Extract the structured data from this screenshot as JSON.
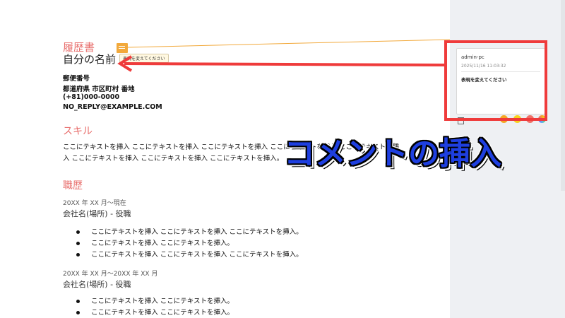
{
  "document": {
    "heading": "履歴書",
    "name": "自分の名前",
    "contact": [
      "郵便番号",
      "都道府県 市区町村 番地",
      "(+81)000-0000",
      "NO_REPLY@EXAMPLE.COM"
    ],
    "skills_heading": "スキル",
    "skills_lines": [
      "ここにテキストを挿入 ここにテキストを挿入 ここにテキストを挿入 ここにテキストを挿入 ここにテキストを挿",
      "入 ここにテキストを挿入 ここにテキストを挿入 ここにテキストを挿入。"
    ],
    "experience_heading": "職歴",
    "jobs": [
      {
        "period": "20XX 年 XX 月～現在",
        "company": "会社名(場所) - 役職",
        "bullets": [
          "ここにテキストを挿入 ここにテキストを挿入 ここにテキストを挿入。",
          "ここにテキストを挿入 ここにテキストを挿入。",
          "ここにテキストを挿入 ここにテキストを挿入 ここにテキストを挿入。"
        ]
      },
      {
        "period": "20XX 年 XX 月～20XX 年 XX 月",
        "company": "会社名(場所) - 役職",
        "bullets": [
          "ここにテキストを挿入 ここにテキストを挿入。",
          "ここにテキストを挿入 ここにテキストを挿入。"
        ]
      }
    ],
    "note_tooltip": "表現を変えてください"
  },
  "comment": {
    "user": "admin-pc",
    "date": "2025/11/16 11:03:32",
    "text": "表現を変えてください"
  },
  "colors": {
    "accent_heading": "#e8706e",
    "annotation_red": "#ef3b3b",
    "connector_orange": "#f2a93b",
    "overlay_blue": "#1e3fe0",
    "swatches": [
      "#f5a623",
      "#f8d21c",
      "#f07167",
      "#7b61ff"
    ]
  },
  "overlay": {
    "title": "コメントの挿入"
  }
}
